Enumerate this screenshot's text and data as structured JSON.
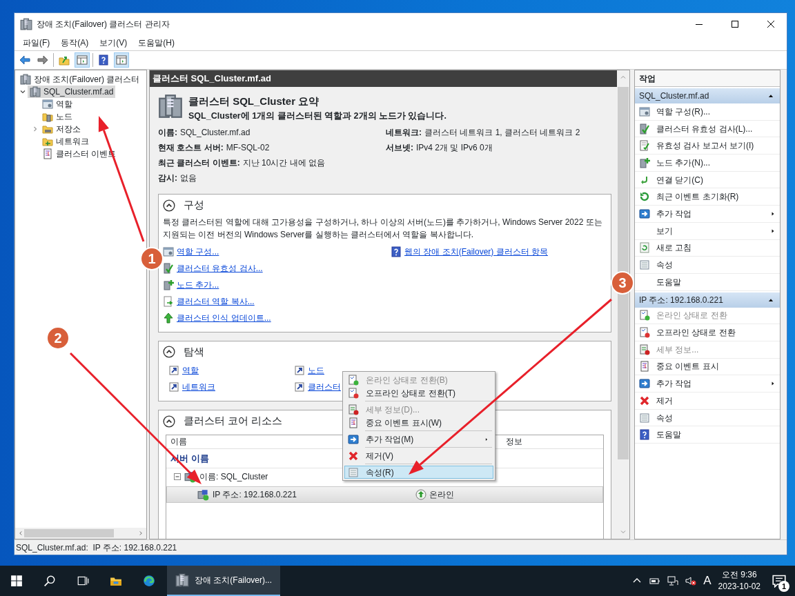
{
  "window": {
    "title": "장애 조치(Failover) 클러스터 관리자"
  },
  "menu": [
    "파일(F)",
    "동작(A)",
    "보기(V)",
    "도움말(H)"
  ],
  "tree": [
    {
      "label": "장애 조치(Failover) 클러스터",
      "selected": false,
      "children": [
        {
          "label": "SQL_Cluster.mf.ad",
          "selected": true,
          "expanded": true,
          "children": [
            {
              "label": "역할",
              "selected": false
            },
            {
              "label": "노드",
              "selected": false
            },
            {
              "label": "저장소",
              "selected": false,
              "expanded": false
            },
            {
              "label": "네트워크",
              "selected": false
            },
            {
              "label": "클러스터 이벤트",
              "selected": false
            }
          ]
        }
      ]
    }
  ],
  "center": {
    "header": "클러스터 SQL_Cluster.mf.ad",
    "summary": {
      "title": "클러스터 SQL_Cluster 요약",
      "subtitle": "SQL_Cluster에 1개의 클러스터된 역할과 2개의 노드가 있습니다.",
      "properties_left": [
        {
          "label": "이름:",
          "value": "SQL_Cluster.mf.ad"
        },
        {
          "label": "현재 호스트 서버:",
          "value": "MF-SQL-02"
        },
        {
          "label": "최근 클러스터 이벤트:",
          "value": "지난 10시간 내에 없음"
        },
        {
          "label": "감시:",
          "value": "없음"
        }
      ],
      "properties_right": [
        {
          "label": "네트워크:",
          "value": "클러스터 네트워크 1, 클러스터 네트워크 2"
        },
        {
          "label": "서브넷:",
          "value": "IPv4 2개 및 IPv6 0개"
        }
      ]
    },
    "configure": {
      "title": "구성",
      "expanded": true,
      "description": "특정 클러스터된 역할에 대해 고가용성을 구성하거나, 하나 이상의 서버(노드)를 추가하거나, Windows Server 2022 또는 지원되는 이전 버전의 Windows Server를 실행하는 클러스터에서 역할을 복사합니다.",
      "links_left": [
        "역할 구성...",
        "클러스터 유효성 검사...",
        "노드 추가...",
        "클러스터 역할 복사...",
        "클러스터 인식 업데이트..."
      ],
      "links_right": [
        "웹의 장애 조치(Failover) 클러스터 항목"
      ]
    },
    "navigate": {
      "title": "탐색",
      "expanded": true,
      "links": [
        "역할",
        "노드",
        "네트워크",
        "클러스터"
      ]
    },
    "core_resources": {
      "title": "클러스터 코어 리소스",
      "expanded": true,
      "columns": [
        "이름",
        "정보"
      ],
      "group": "서버 이름",
      "rows": [
        {
          "name": "이름: SQL_Cluster",
          "expanded": true,
          "selected": false
        },
        {
          "name": "IP 주소: 192.168.0.221",
          "status": "온라인",
          "selected": true
        }
      ]
    }
  },
  "context_menu": {
    "groups": [
      [
        {
          "label": "온라인 상태로 전환(B)",
          "disabled": true,
          "submenu": false,
          "selected": false
        },
        {
          "label": "오프라인 상태로 전환(T)",
          "disabled": false,
          "submenu": false,
          "selected": false
        }
      ],
      [
        {
          "label": "세부 정보(D)...",
          "disabled": true,
          "submenu": false,
          "selected": false
        },
        {
          "label": "중요 이벤트 표시(W)",
          "disabled": false,
          "submenu": false,
          "selected": false
        }
      ],
      [
        {
          "label": "추가 작업(M)",
          "disabled": false,
          "submenu": true,
          "selected": false
        }
      ],
      [
        {
          "label": "제거(V)",
          "disabled": false,
          "submenu": false,
          "selected": false
        }
      ],
      [
        {
          "label": "속성(R)",
          "disabled": false,
          "submenu": false,
          "selected": true
        }
      ]
    ]
  },
  "actions": {
    "title": "작업",
    "groups": [
      {
        "title": "SQL_Cluster.mf.ad",
        "expanded": true,
        "items": [
          {
            "label": "역할 구성(R)...",
            "disabled": false,
            "submenu": false
          },
          {
            "label": "클러스터 유효성 검사(L)...",
            "disabled": false,
            "submenu": false
          },
          {
            "label": "유효성 검사 보고서 보기(I)",
            "disabled": false,
            "submenu": false
          },
          {
            "label": "노드 추가(N)...",
            "disabled": false,
            "submenu": false
          },
          {
            "label": "연결 닫기(C)",
            "disabled": false,
            "submenu": false
          },
          {
            "label": "최근 이벤트 초기화(R)",
            "disabled": false,
            "submenu": false
          },
          {
            "label": "추가 작업",
            "disabled": false,
            "submenu": true
          },
          {
            "label": "보기",
            "disabled": false,
            "submenu": true
          },
          {
            "label": "새로 고침",
            "disabled": false,
            "submenu": false
          },
          {
            "label": "속성",
            "disabled": false,
            "submenu": false
          },
          {
            "label": "도움말",
            "disabled": false,
            "submenu": false
          }
        ]
      },
      {
        "title": "IP 주소: 192.168.0.221",
        "expanded": true,
        "items": [
          {
            "label": "온라인 상태로 전환",
            "disabled": true,
            "submenu": false
          },
          {
            "label": "오프라인 상태로 전환",
            "disabled": false,
            "submenu": false
          },
          {
            "label": "세부 정보...",
            "disabled": true,
            "submenu": false
          },
          {
            "label": "중요 이벤트 표시",
            "disabled": false,
            "submenu": false
          },
          {
            "label": "추가 작업",
            "disabled": false,
            "submenu": true
          },
          {
            "label": "제거",
            "disabled": false,
            "submenu": false
          },
          {
            "label": "속성",
            "disabled": false,
            "submenu": false
          },
          {
            "label": "도움말",
            "disabled": false,
            "submenu": false
          }
        ]
      }
    ]
  },
  "status_bar": {
    "text": "SQL_Cluster.mf.ad:  IP 주소: 192.168.0.221"
  },
  "annotations": [
    {
      "number": "1"
    },
    {
      "number": "2"
    },
    {
      "number": "3"
    }
  ],
  "taskbar": {
    "apps": [
      {
        "label": "장애 조치(Failover)...",
        "active": true
      }
    ],
    "ime": "A",
    "time": "오전 9:36",
    "date": "2023-10-02",
    "notifications": "1"
  }
}
